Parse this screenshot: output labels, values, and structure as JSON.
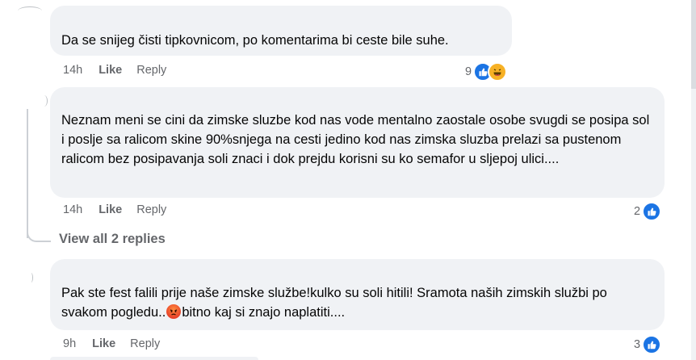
{
  "comments": [
    {
      "text": "Da se snijeg čisti tipkovnicom, po komentarima bi ceste bile suhe.",
      "time": "14h",
      "like_label": "Like",
      "reply_label": "Reply",
      "reaction_count": "9",
      "reactions": [
        "like-icon",
        "haha-icon"
      ]
    },
    {
      "text": "Neznam meni se cini da zimske sluzbe kod nas vode mentalno zaostale osobe svugdi se posipa sol i poslje sa ralicom skine 90%snjega na cesti jedino kod nas zimska sluzba prelazi sa pustenom ralicom bez posipavanja soli znaci i dok prejdu korisni su ko semafor u sljepoj ulici....",
      "time": "14h",
      "like_label": "Like",
      "reply_label": "Reply",
      "reaction_count": "2",
      "reactions": [
        "like-icon"
      ]
    },
    {
      "text_part1": "Pak ste fest falili prije naše zimske službe!kulko su soli hitili! Sramota naših zimskih službi po svakom pogledu..",
      "text_part2": "bitno kaj si znajo naplatiti....",
      "inline_emoji": "angry-face-emoji",
      "time": "9h",
      "like_label": "Like",
      "reply_label": "Reply",
      "reaction_count": "3",
      "reactions": [
        "like-icon"
      ]
    }
  ],
  "view_replies_label": "View all 2 replies",
  "colors": {
    "bubble_bg": "#f0f2f5",
    "meta_text": "#65676b",
    "like_blue": "#1b74e4",
    "haha_yellow": "#f7b125"
  }
}
